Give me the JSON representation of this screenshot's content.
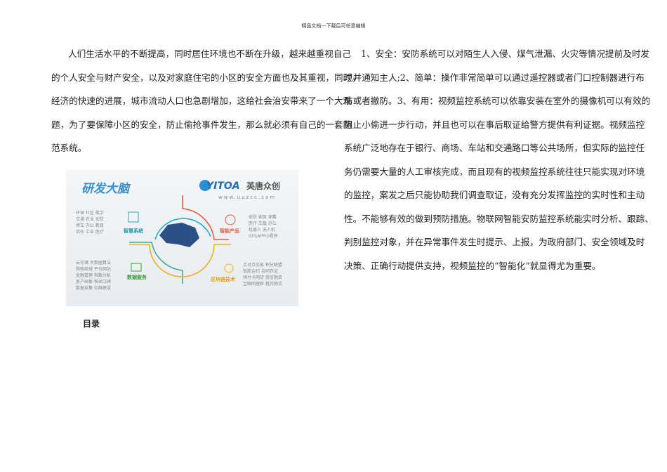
{
  "header": "精品文档---下载后可任意编辑",
  "left_lines": [
    "人们生活水平的不断提高，同时居住环境也不断在升级，越来越重视自己",
    "的个人安全与财产安全，以及对家庭住宅的小区的安全方面也及其重视，同时，",
    "经济的快速的进展，城市流动人口也急剧增加，这给社会治安带来了一个大难",
    "题，为了要保障小区的安全，防止偷抢事件发生，那么就必须有自己的一套防",
    "范系统。"
  ],
  "right_lines": [
    "1、安全：安防系统可以对陌生人入侵、煤气泄漏、火灾等情况提前及时发",
    "现并通知主人;2、简单：操作非常简单可以通过遥控器或者门口控制器进行布",
    "防或者撤防。3、有用：视频监控系统可以依靠安装在室外的摄像机可以有效的",
    "阻止小偷进一步行动，并且也可以在事后取证给警方提供有利证据。视频监控",
    "系统广泛地存在于银行、商场、车站和交通路口等公共场所，但实际的监控任",
    "务仍需要大量的人工审核完成，而且现有的视频监控系统往往只能实现对环境",
    "的监控，案发之后只能协助我们调查取证，没有充分发挥监控的实时性和主动",
    "性。不能够有效的做到预防措施。物联网智能安防监控系统能实时分析、跟踪、",
    "判别监控对象，并在异常事件发生时提示、上报，为政府部门、安全领域及时",
    "决策、正确行动提供支持，视频监控的“智能化”就显得尤为重要。"
  ],
  "image": {
    "title": "研发大脑",
    "brand": "YITOA",
    "brand_cn": "英唐众创",
    "url": "www.uuzcc.com",
    "q1": {
      "label": "智慧系统",
      "lines": [
        "环保 社区 楼宇",
        "交通 农业 安防",
        "停车 办公 教育",
        "供水 工业 医疗"
      ]
    },
    "q2": {
      "label": "智能产品",
      "lines": [
        "安防 家居 穿戴",
        "医疗 车载 办公",
        "机器人  无人机",
        "IOS\\APP小程序"
      ]
    },
    "q3": {
      "label": "数据服务",
      "lines": [
        "云存储 大数据算法",
        "购物商城 平台网站",
        "金融管理 指数分析",
        "客户画像 粉丝口碑",
        "数据采集 社群建设"
      ]
    },
    "q4": {
      "label": "区块链技术",
      "lines": [
        "点对点交易 积分联盟",
        "智能合约  合同存证",
        "预付卡网贷 授信融资",
        "互联网理财 租凭物流"
      ]
    }
  },
  "toc": "目录"
}
